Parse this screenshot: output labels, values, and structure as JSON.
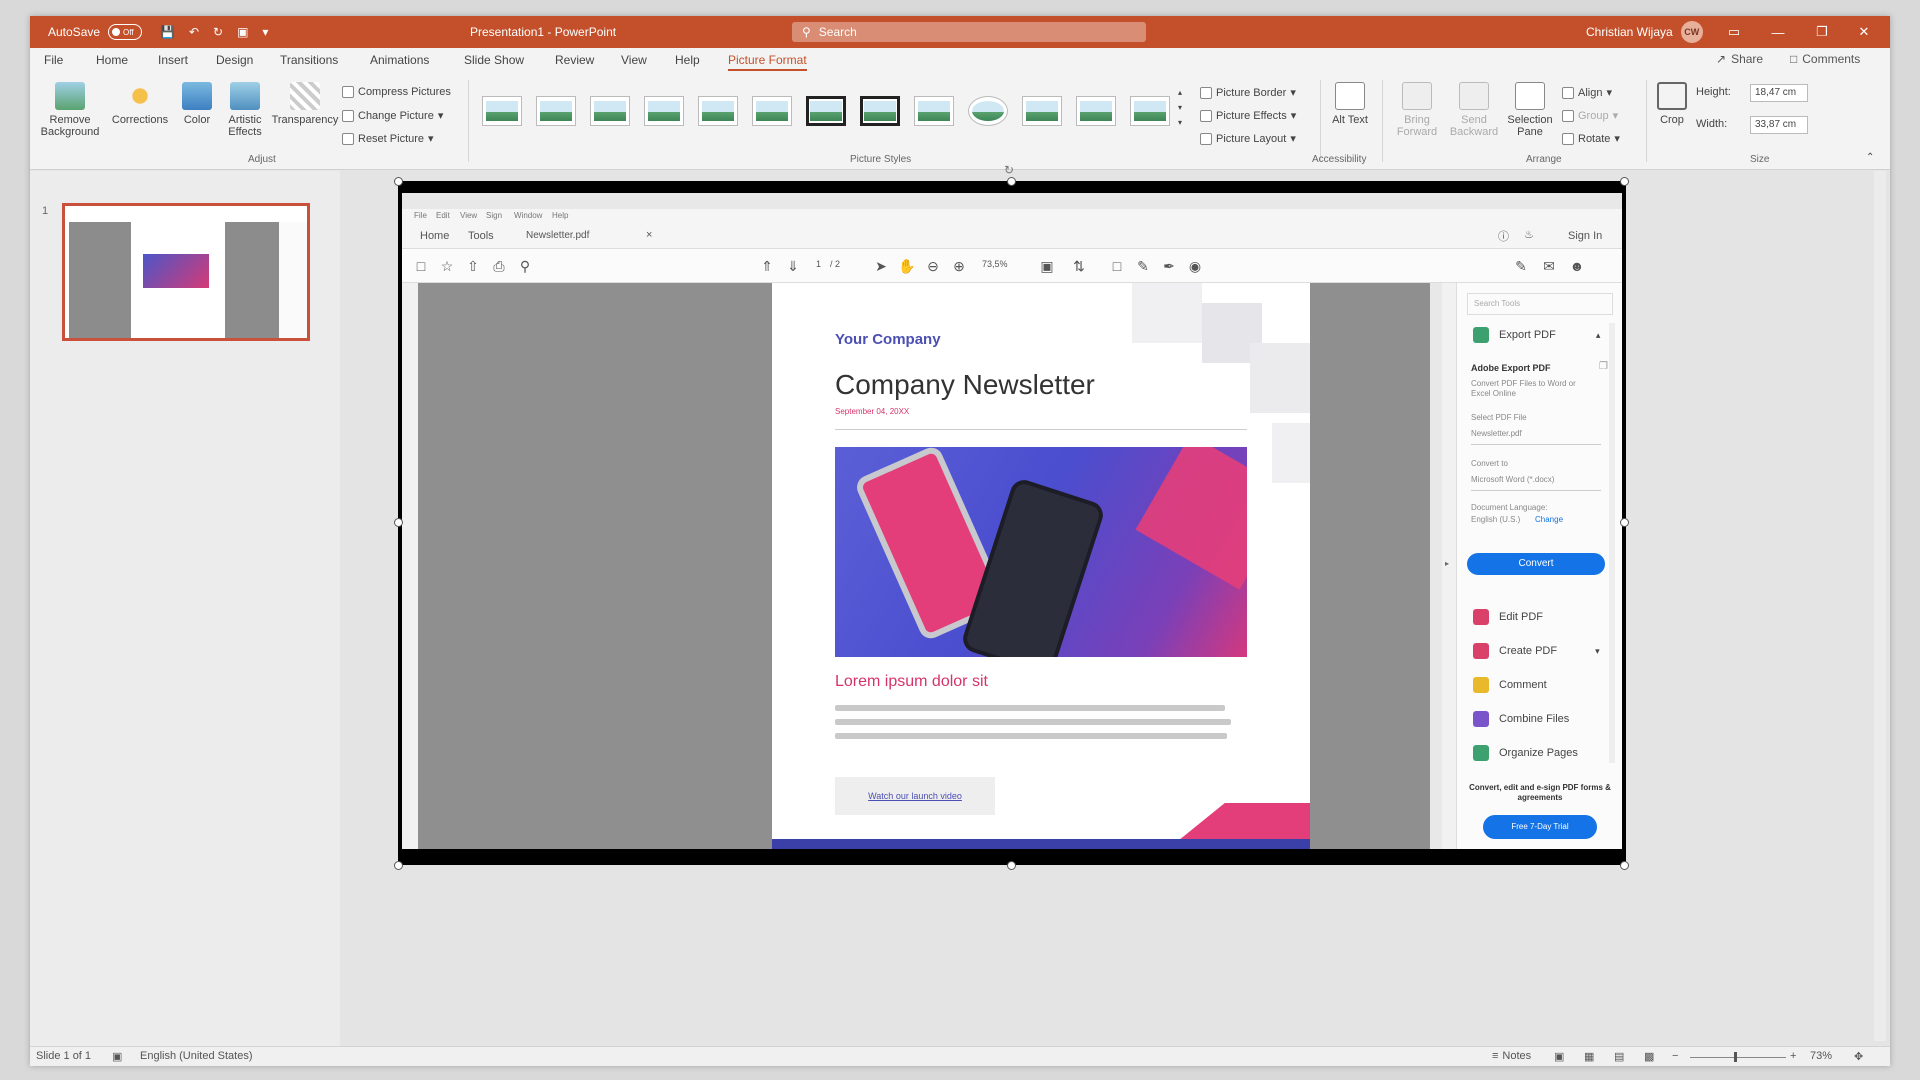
{
  "titlebar": {
    "autosave_label": "AutoSave",
    "autosave_state": "Off",
    "file_title": "Presentation1 - PowerPoint",
    "search_placeholder": "Search",
    "user_name": "Christian Wijaya",
    "user_initials": "CW"
  },
  "menu": {
    "tabs": [
      "File",
      "Home",
      "Insert",
      "Design",
      "Transitions",
      "Animations",
      "Slide Show",
      "Review",
      "View",
      "Help",
      "Picture Format"
    ],
    "active_tab": "Picture Format",
    "share": "Share",
    "comments": "Comments"
  },
  "ribbon": {
    "adjust": {
      "remove_background": "Remove Background",
      "corrections": "Corrections",
      "color": "Color",
      "artistic_effects": "Artistic Effects",
      "transparency": "Transparency",
      "compress": "Compress Pictures",
      "change": "Change Picture",
      "reset": "Reset Picture",
      "label": "Adjust"
    },
    "picture_styles_label": "Picture Styles",
    "style_options": {
      "border": "Picture Border",
      "effects": "Picture Effects",
      "layout": "Picture Layout"
    },
    "accessibility": {
      "alt_text": "Alt Text",
      "label": "Accessibility"
    },
    "arrange": {
      "bring_forward": "Bring Forward",
      "send_backward": "Send Backward",
      "selection_pane": "Selection Pane",
      "align": "Align",
      "group": "Group",
      "rotate": "Rotate",
      "label": "Arrange"
    },
    "size": {
      "crop": "Crop",
      "height_label": "Height:",
      "height_value": "18,47 cm",
      "width_label": "Width:",
      "width_value": "33,87 cm",
      "label": "Size"
    }
  },
  "thumbs": {
    "slide_number": "1"
  },
  "acrobat": {
    "menu_items": [
      "File",
      "Edit",
      "View",
      "Sign",
      "Window",
      "Help"
    ],
    "tab_home": "Home",
    "tab_tools": "Tools",
    "doc_tab": "Newsletter.pdf",
    "sign_in": "Sign In",
    "page_current": "1",
    "page_total": "/ 2",
    "zoom": "73,5%",
    "tools_search_placeholder": "Search Tools",
    "tools": {
      "export_pdf": "Export PDF",
      "adobe_export": "Adobe Export PDF",
      "convert_desc": "Convert PDF Files to Word or Excel Online",
      "select_file": "Select PDF File",
      "file_name": "Newsletter.pdf",
      "convert_to": "Convert to",
      "format": "Microsoft Word (*.docx)",
      "doc_language": "Document Language:",
      "language_value": "English (U.S.)",
      "change": "Change",
      "convert_button": "Convert",
      "edit_pdf": "Edit PDF",
      "create_pdf": "Create PDF",
      "comment": "Comment",
      "combine": "Combine Files",
      "organize": "Organize Pages",
      "promo": "Convert, edit and e-sign PDF forms & agreements",
      "trial": "Free 7-Day Trial"
    }
  },
  "newsletter": {
    "company": "Your Company",
    "title": "Company Newsletter",
    "date": "September 04, 20XX",
    "heading": "Lorem ipsum dolor sit",
    "button": "Watch our launch video"
  },
  "statusbar": {
    "slide_info": "Slide 1 of 1",
    "language": "English (United States)",
    "notes": "Notes",
    "zoom": "73%"
  },
  "colors": {
    "accent": "#c3502a",
    "brand_purple": "#4b4fb3",
    "brand_pink": "#d6336c",
    "acrobat_blue": "#1473e6"
  }
}
